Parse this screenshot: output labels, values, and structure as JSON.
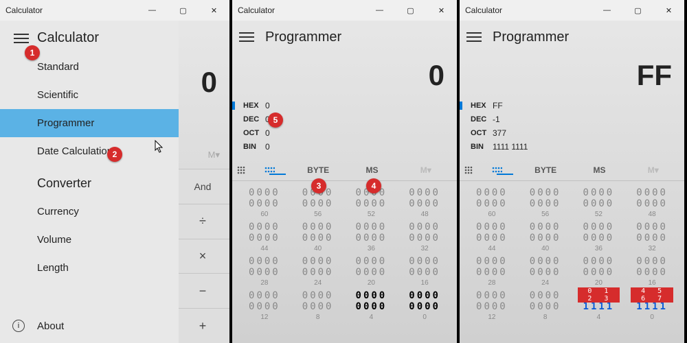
{
  "app_title": "Calculator",
  "win1": {
    "mode": "Calculator",
    "display": "0",
    "menu": {
      "items": [
        "Standard",
        "Scientific",
        "Programmer",
        "Date Calculation"
      ],
      "selected_index": 2,
      "section": "Converter",
      "conv": [
        "Currency",
        "Volume",
        "Length"
      ],
      "about": "About"
    },
    "strip": {
      "mh": "M▾",
      "buttons": [
        "And",
        "÷",
        "×",
        "−",
        "+"
      ]
    }
  },
  "win2": {
    "mode": "Programmer",
    "display": "0",
    "bases": {
      "HEX": "0",
      "DEC": "0",
      "OCT": "0",
      "BIN": "0",
      "active": "HEX"
    },
    "toolbar": {
      "keypad": "⠿",
      "bits": "⠛",
      "byte": "BYTE",
      "ms": "MS",
      "mh": "M▾",
      "selected": 1
    },
    "bitgrid": {
      "rows": [
        [
          {
            "bits": "0000",
            "idx": ""
          },
          {
            "bits": "0000",
            "idx": "60"
          },
          {
            "bits": "0000",
            "idx": ""
          },
          {
            "bits": "0000",
            "idx": "56"
          },
          {
            "bits": "0000",
            "idx": ""
          },
          {
            "bits": "0000",
            "idx": "52"
          },
          {
            "bits": "0000",
            "idx": ""
          },
          {
            "bits": "0000",
            "idx": "48"
          }
        ],
        [
          {
            "bits": "0000",
            "idx": ""
          },
          {
            "bits": "0000",
            "idx": "44"
          },
          {
            "bits": "0000",
            "idx": ""
          },
          {
            "bits": "0000",
            "idx": "40"
          },
          {
            "bits": "0000",
            "idx": ""
          },
          {
            "bits": "0000",
            "idx": "36"
          },
          {
            "bits": "0000",
            "idx": ""
          },
          {
            "bits": "0000",
            "idx": "32"
          }
        ],
        [
          {
            "bits": "0000",
            "idx": ""
          },
          {
            "bits": "0000",
            "idx": "28"
          },
          {
            "bits": "0000",
            "idx": ""
          },
          {
            "bits": "0000",
            "idx": "24"
          },
          {
            "bits": "0000",
            "idx": ""
          },
          {
            "bits": "0000",
            "idx": "20"
          },
          {
            "bits": "0000",
            "idx": ""
          },
          {
            "bits": "0000",
            "idx": "16"
          }
        ],
        [
          {
            "bits": "0000",
            "idx": ""
          },
          {
            "bits": "0000",
            "idx": "12"
          },
          {
            "bits": "0000",
            "idx": ""
          },
          {
            "bits": "0000",
            "idx": "8"
          },
          {
            "bits": "0000",
            "idx": "",
            "bold": true
          },
          {
            "bits": "0000",
            "idx": "4",
            "bold": true
          },
          {
            "bits": "0000",
            "idx": "",
            "bold": true
          },
          {
            "bits": "0000",
            "idx": "0",
            "bold": true
          }
        ]
      ]
    }
  },
  "win3": {
    "mode": "Programmer",
    "display": "FF",
    "bases": {
      "HEX": "FF",
      "DEC": "-1",
      "OCT": "377",
      "BIN": "1111 1111",
      "active": "HEX"
    },
    "toolbar": {
      "keypad": "⠿",
      "bits": "⠛",
      "byte": "BYTE",
      "ms": "MS",
      "mh": "M▾",
      "selected": 1
    },
    "bitgrid": {
      "rows": [
        [
          {
            "bits": "0000",
            "idx": ""
          },
          {
            "bits": "0000",
            "idx": "60"
          },
          {
            "bits": "0000",
            "idx": ""
          },
          {
            "bits": "0000",
            "idx": "56"
          },
          {
            "bits": "0000",
            "idx": ""
          },
          {
            "bits": "0000",
            "idx": "52"
          },
          {
            "bits": "0000",
            "idx": ""
          },
          {
            "bits": "0000",
            "idx": "48"
          }
        ],
        [
          {
            "bits": "0000",
            "idx": ""
          },
          {
            "bits": "0000",
            "idx": "44"
          },
          {
            "bits": "0000",
            "idx": ""
          },
          {
            "bits": "0000",
            "idx": "40"
          },
          {
            "bits": "0000",
            "idx": ""
          },
          {
            "bits": "0000",
            "idx": "36"
          },
          {
            "bits": "0000",
            "idx": ""
          },
          {
            "bits": "0000",
            "idx": "32"
          }
        ],
        [
          {
            "bits": "0000",
            "idx": ""
          },
          {
            "bits": "0000",
            "idx": "28"
          },
          {
            "bits": "0000",
            "idx": ""
          },
          {
            "bits": "0000",
            "idx": "24"
          },
          {
            "bits": "0000",
            "idx": ""
          },
          {
            "bits": "0000",
            "idx": "20"
          },
          {
            "bits": "0000",
            "idx": ""
          },
          {
            "bits": "0000",
            "idx": "16"
          }
        ],
        [
          {
            "bits": "0000",
            "idx": ""
          },
          {
            "bits": "0000",
            "idx": "12"
          },
          {
            "bits": "0000",
            "idx": ""
          },
          {
            "bits": "0000",
            "idx": "8"
          },
          {
            "bits": "1111",
            "idx": "",
            "blue": true,
            "over": "0 1 2 3"
          },
          {
            "bits": "1111",
            "idx": "4",
            "blue": true
          },
          {
            "bits": "1111",
            "idx": "",
            "blue": true,
            "over": "4 5 6 7"
          },
          {
            "bits": "1111",
            "idx": "0",
            "blue": true
          }
        ]
      ]
    }
  },
  "badges": {
    "1": "1",
    "2": "2",
    "3": "3",
    "4": "4",
    "5": "5"
  }
}
